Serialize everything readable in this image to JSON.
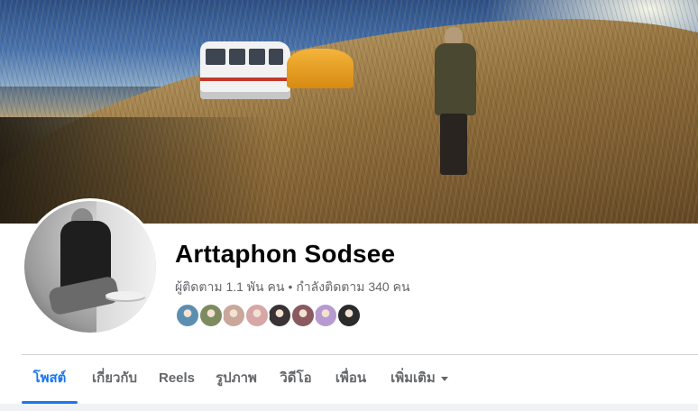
{
  "profile": {
    "name": "Arttaphon Sodsee",
    "followers": "ผู้ติดตาม 1.1 พัน คน",
    "separator": "•",
    "following": "กำลังติดตาม 340 คน"
  },
  "friends_preview": [
    {
      "label": "friend-1",
      "color": "#5b8fb2"
    },
    {
      "label": "friend-2",
      "color": "#7d8b5e"
    },
    {
      "label": "friend-3",
      "color": "#c9a79a"
    },
    {
      "label": "friend-4",
      "color": "#d7a6a6"
    },
    {
      "label": "friend-5",
      "color": "#3a3336"
    },
    {
      "label": "friend-6",
      "color": "#8a5a60"
    },
    {
      "label": "friend-7",
      "color": "#b79ad0"
    },
    {
      "label": "friend-8",
      "color": "#2b2b2b"
    }
  ],
  "tabs": [
    {
      "label": "โพสต์",
      "active": true
    },
    {
      "label": "เกี่ยวกับ",
      "active": false
    },
    {
      "label": "Reels",
      "active": false
    },
    {
      "label": "รูปภาพ",
      "active": false
    },
    {
      "label": "วิดีโอ",
      "active": false
    },
    {
      "label": "เพื่อน",
      "active": false
    },
    {
      "label": "เพิ่มเติม",
      "active": false
    }
  ],
  "colors": {
    "accent": "#1877f2",
    "secondary_text": "#65676b",
    "name_text": "#050505"
  }
}
